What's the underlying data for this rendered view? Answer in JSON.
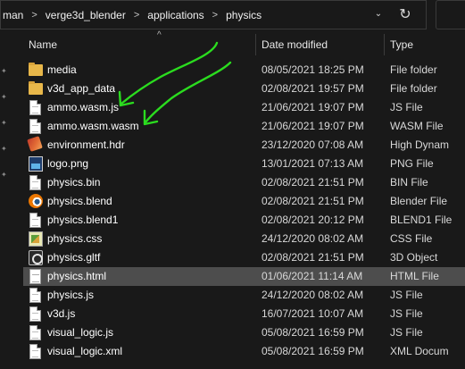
{
  "address_bar": {
    "crumbs": [
      "man",
      "verge3d_blender",
      "applications",
      "physics"
    ],
    "dropdown_glyph": "⌄",
    "refresh_glyph": "↻"
  },
  "columns": {
    "name": "Name",
    "date": "Date modified",
    "type": "Type"
  },
  "files": [
    {
      "name": "media",
      "date": "08/05/2021 18:25 PM",
      "type": "File folder",
      "icon": "folder-icon"
    },
    {
      "name": "v3d_app_data",
      "date": "02/08/2021 19:57 PM",
      "type": "File folder",
      "icon": "folder-icon"
    },
    {
      "name": "ammo.wasm.js",
      "date": "21/06/2021 19:07 PM",
      "type": "JS File",
      "icon": "document-icon"
    },
    {
      "name": "ammo.wasm.wasm",
      "date": "21/06/2021 19:07 PM",
      "type": "WASM File",
      "icon": "document-icon"
    },
    {
      "name": "environment.hdr",
      "date": "23/12/2020 07:08 AM",
      "type": "High Dynam",
      "icon": "hdr-image-icon"
    },
    {
      "name": "logo.png",
      "date": "13/01/2021 07:13 AM",
      "type": "PNG File",
      "icon": "png-image-icon"
    },
    {
      "name": "physics.bin",
      "date": "02/08/2021 21:51 PM",
      "type": "BIN File",
      "icon": "document-icon"
    },
    {
      "name": "physics.blend",
      "date": "02/08/2021 21:51 PM",
      "type": "Blender File",
      "icon": "blender-icon"
    },
    {
      "name": "physics.blend1",
      "date": "02/08/2021 20:12 PM",
      "type": "BLEND1 File",
      "icon": "document-icon"
    },
    {
      "name": "physics.css",
      "date": "24/12/2020 08:02 AM",
      "type": "CSS File",
      "icon": "css-icon"
    },
    {
      "name": "physics.gltf",
      "date": "02/08/2021 21:51 PM",
      "type": "3D Object",
      "icon": "3d-object-icon"
    },
    {
      "name": "physics.html",
      "date": "01/06/2021 11:14 AM",
      "type": "HTML File",
      "icon": "html-icon",
      "selected": true
    },
    {
      "name": "physics.js",
      "date": "24/12/2020 08:02 AM",
      "type": "JS File",
      "icon": "document-icon"
    },
    {
      "name": "v3d.js",
      "date": "16/07/2021 10:07 AM",
      "type": "JS File",
      "icon": "document-icon"
    },
    {
      "name": "visual_logic.js",
      "date": "05/08/2021 16:59 PM",
      "type": "JS File",
      "icon": "document-icon"
    },
    {
      "name": "visual_logic.xml",
      "date": "05/08/2021 16:59 PM",
      "type": "XML Docum",
      "icon": "document-icon"
    }
  ],
  "colors": {
    "background": "#191919",
    "selected_row": "#4d4d4d",
    "folder": "#e8b74a",
    "annotation": "#2bdc1f"
  }
}
